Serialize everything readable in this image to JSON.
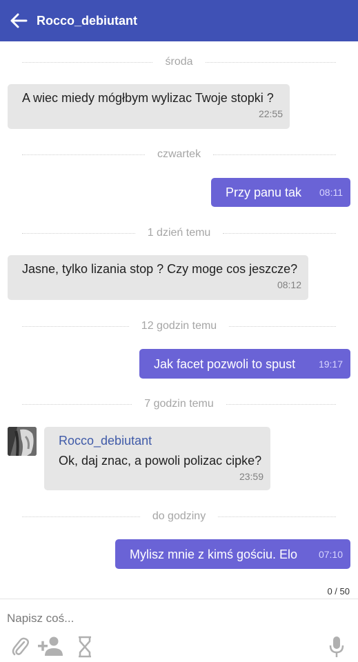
{
  "header": {
    "title": "Rocco_debiutant",
    "background": "#3f51b5"
  },
  "dividers": [
    "środa",
    "czwartek",
    "1 dzień temu",
    "12 godzin temu",
    "7 godzin temu",
    "do godziny"
  ],
  "messages": [
    {
      "direction": "in",
      "text": "A wiec miedy mógłbym wylizac Twoje stopki ?",
      "time": "22:55"
    },
    {
      "direction": "out",
      "text": "Przy panu tak",
      "time": "08:11"
    },
    {
      "direction": "in",
      "text": "Jasne, tylko lizania stop ? Czy moge cos jeszcze?",
      "time": "08:12"
    },
    {
      "direction": "out",
      "text": "Jak facet pozwoli to spust",
      "time": "19:17"
    },
    {
      "direction": "in",
      "sender": "Rocco_debiutant",
      "text": "Ok, daj znac, a powoli polizac cipke?",
      "time": "23:59"
    },
    {
      "direction": "out",
      "text": "Mylisz mnie z kimś gościu. Elo",
      "time": "07:10"
    }
  ],
  "composer": {
    "counter": "0 / 50",
    "placeholder": "Napisz coś...",
    "icons": [
      "paperclip-icon",
      "add-person-icon",
      "hourglass-icon",
      "microphone-icon"
    ]
  },
  "colors": {
    "outgoing_bubble": "#6a63d6",
    "incoming_bubble": "#e6e6e6",
    "sender_name": "#3f5aa8"
  }
}
